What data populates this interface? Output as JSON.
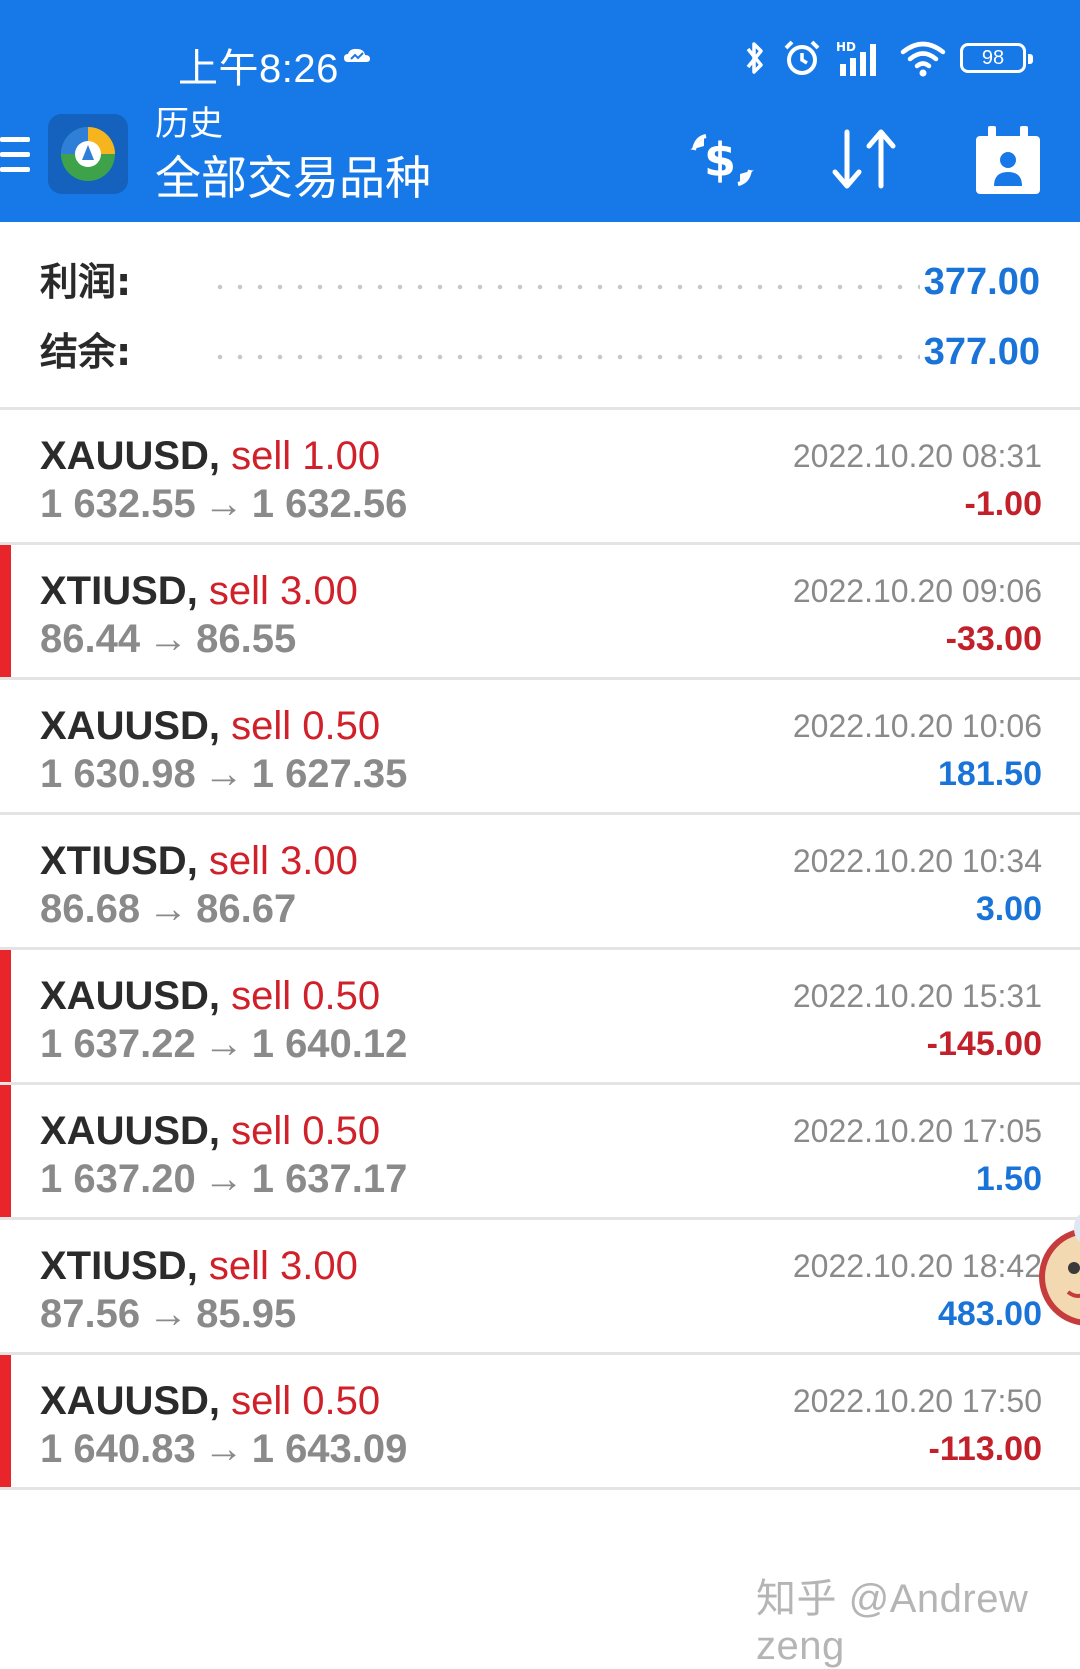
{
  "status_bar": {
    "time": "上午8:26",
    "battery": "98",
    "icons": [
      "bluetooth-icon",
      "alarm-icon",
      "hd-signal-icon",
      "wifi-icon",
      "battery-icon"
    ]
  },
  "header": {
    "subtitle": "历史",
    "title": "全部交易品种",
    "actions": [
      "currency-exchange-icon",
      "sort-icon",
      "calendar-person-icon"
    ],
    "colors": {
      "bar": "#1779e8"
    }
  },
  "summary": {
    "profit_label": "利润:",
    "profit_value": "377.00",
    "balance_label": "结余:",
    "balance_value": "377.00"
  },
  "trades": [
    {
      "symbol": "XAUUSD",
      "side": "sell 1.00",
      "open": "1 632.55",
      "close": "1 632.56",
      "time": "2022.10.20 08:31",
      "profit": "-1.00",
      "sign": "neg",
      "flag": false
    },
    {
      "symbol": "XTIUSD",
      "side": "sell 3.00",
      "open": "86.44",
      "close": "86.55",
      "time": "2022.10.20 09:06",
      "profit": "-33.00",
      "sign": "neg",
      "flag": true
    },
    {
      "symbol": "XAUUSD",
      "side": "sell 0.50",
      "open": "1 630.98",
      "close": "1 627.35",
      "time": "2022.10.20 10:06",
      "profit": "181.50",
      "sign": "pos",
      "flag": false
    },
    {
      "symbol": "XTIUSD",
      "side": "sell 3.00",
      "open": "86.68",
      "close": "86.67",
      "time": "2022.10.20 10:34",
      "profit": "3.00",
      "sign": "pos",
      "flag": false
    },
    {
      "symbol": "XAUUSD",
      "side": "sell 0.50",
      "open": "1 637.22",
      "close": "1 640.12",
      "time": "2022.10.20 15:31",
      "profit": "-145.00",
      "sign": "neg",
      "flag": true
    },
    {
      "symbol": "XAUUSD",
      "side": "sell 0.50",
      "open": "1 637.20",
      "close": "1 637.17",
      "time": "2022.10.20 17:05",
      "profit": "1.50",
      "sign": "pos",
      "flag": true
    },
    {
      "symbol": "XTIUSD",
      "side": "sell 3.00",
      "open": "87.56",
      "close": "85.95",
      "time": "2022.10.20 18:42",
      "profit": "483.00",
      "sign": "pos",
      "flag": false
    },
    {
      "symbol": "XAUUSD",
      "side": "sell 0.50",
      "open": "1 640.83",
      "close": "1 643.09",
      "time": "2022.10.20 17:50",
      "profit": "-113.00",
      "sign": "neg",
      "flag": true
    }
  ],
  "arrow": "→",
  "watermark": "知乎 @Andrew zeng"
}
